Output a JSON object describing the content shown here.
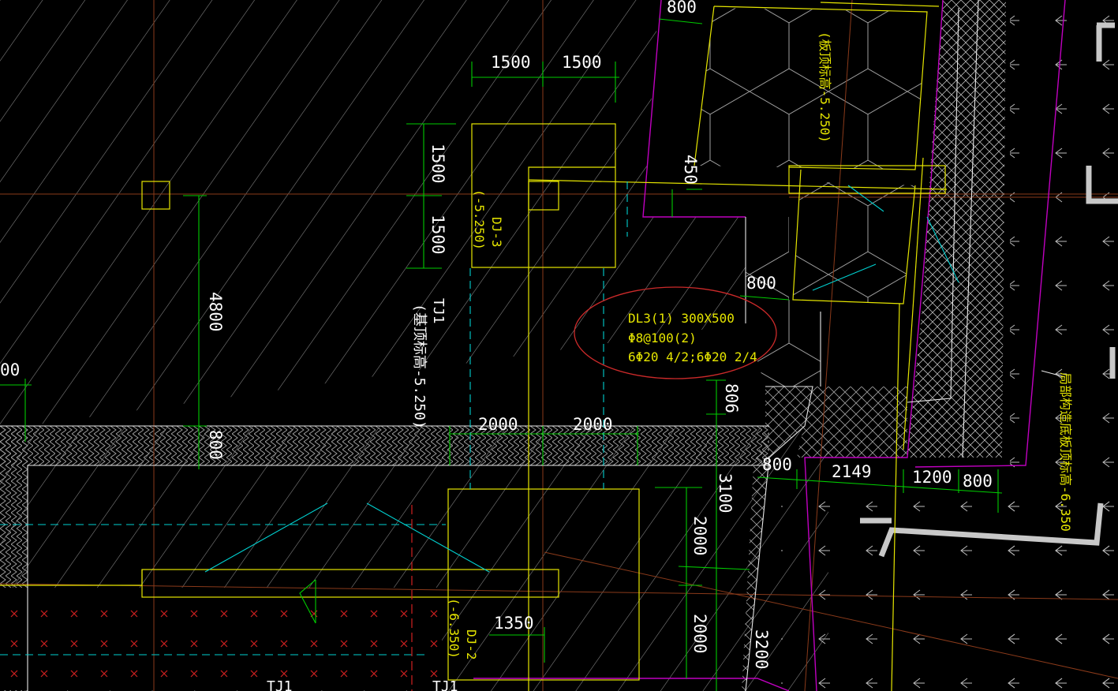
{
  "drawing": {
    "colors": {
      "background": "#000000",
      "hatch": "#8a8a8a",
      "axis": "#8a3a1a",
      "outline_yellow": "#e6e600",
      "dimension_green": "#00cc00",
      "outline_magenta": "#c000c0",
      "cyan": "#00d0d0",
      "red_marks": "#d02020",
      "text": "#ffffff",
      "annotation_circle": "#cc2a2a"
    },
    "top_label": "800",
    "dims_top": [
      "1500",
      "1500"
    ],
    "dims_vertical_left": [
      "1500",
      "1500"
    ],
    "dim_4800": "4800",
    "dim_800_lower": "800",
    "dim_00_left": "00",
    "dims_2000": [
      "2000",
      "2000"
    ],
    "dim_450": "450",
    "dim_800_mid": "800",
    "dim_806": "806",
    "dim_3100": "3100",
    "dim_2000_right": "2000",
    "dim_2000_bottom": "2000",
    "dim_1350": "1350",
    "dim_3200": "3200",
    "dims_bottom_row": [
      "800",
      "2149",
      "1200",
      "800"
    ],
    "footing_dj3": {
      "name": "DJ-3",
      "elev": "(-5.250)"
    },
    "footing_dj2": {
      "name": "DJ-2",
      "elev": "(-6.350)"
    },
    "strip_tj1": {
      "name": "TJ1",
      "elev": "(基顶标高-5.250)"
    },
    "bottom_labels": [
      "TJ1",
      "TJ1"
    ],
    "slab_top_elev": "(板顶标高-5.250)",
    "right_note": "局部构造底板顶标高-6.350",
    "beam_callout": {
      "line1": "DL3(1) 300X500",
      "line2": "Φ8@100(2)",
      "line3": "6Φ20 4/2;6Φ20 2/4"
    }
  }
}
